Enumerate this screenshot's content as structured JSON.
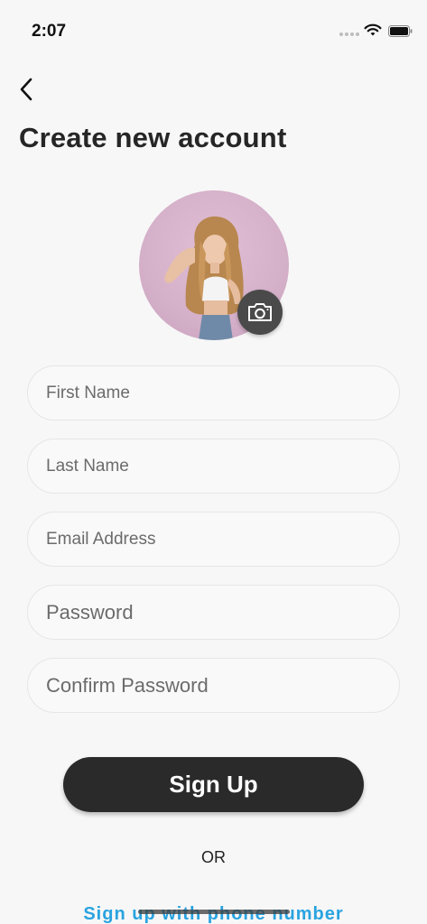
{
  "status_bar": {
    "time": "2:07"
  },
  "header": {
    "title": "Create new account"
  },
  "form": {
    "first_name": {
      "value": "",
      "placeholder": "First Name"
    },
    "last_name": {
      "value": "",
      "placeholder": "Last Name"
    },
    "email": {
      "value": "",
      "placeholder": "Email Address"
    },
    "password": {
      "value": "",
      "placeholder": "Password"
    },
    "confirm_password": {
      "value": "",
      "placeholder": "Confirm Password"
    }
  },
  "actions": {
    "signup_label": "Sign Up",
    "or_label": "OR",
    "phone_link": "Sign up with phone number"
  },
  "colors": {
    "primary_button": "#2a2a2a",
    "link": "#29a3e0",
    "background": "#f7f7f7"
  },
  "icons": {
    "back": "chevron-left-icon",
    "camera": "camera-icon",
    "wifi": "wifi-icon",
    "battery": "battery-icon"
  }
}
